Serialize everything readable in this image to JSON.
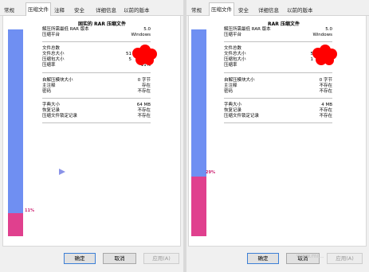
{
  "tabs": [
    "常规",
    "压缩文件",
    "注释",
    "安全",
    "详细信息",
    "以前的版本"
  ],
  "left": {
    "title": "固实的 RAR 压缩文件",
    "rows_a": [
      {
        "label": "解压所需最低 RAR 版本",
        "value": "5.0"
      },
      {
        "label": "压缩平台",
        "value": "Windows"
      }
    ],
    "rows_b": [
      {
        "label": "文件总数",
        "value": ""
      },
      {
        "label": "文件总大小",
        "value": "51"
      },
      {
        "label": "压缩包大小",
        "value": "5"
      },
      {
        "label": "压缩率",
        "value": "11%"
      }
    ],
    "rows_c": [
      {
        "label": "自解压模块大小",
        "value": "0 字节"
      },
      {
        "label": "主注释",
        "value": "存在"
      },
      {
        "label": "密码",
        "value": "不存在"
      }
    ],
    "rows_d": [
      {
        "label": "字典大小",
        "value": "64 MB"
      },
      {
        "label": "恢复记录",
        "value": "不存在"
      },
      {
        "label": "压缩文件锁定记录",
        "value": "不存在"
      }
    ],
    "ratio_percent": 11,
    "ratio_label": "11%"
  },
  "right": {
    "title": "RAR 压缩文件",
    "rows_a": [
      {
        "label": "解压所需最低 RAR 版本",
        "value": "5.0"
      },
      {
        "label": "压缩平台",
        "value": "Windows"
      }
    ],
    "rows_b": [
      {
        "label": "文件总数",
        "value": ""
      },
      {
        "label": "文件总大小",
        "value": "5"
      },
      {
        "label": "压缩包大小",
        "value": "1"
      },
      {
        "label": "压缩率",
        "value": ""
      }
    ],
    "rows_c": [
      {
        "label": "自解压模块大小",
        "value": "0 字节"
      },
      {
        "label": "主注释",
        "value": "不存在"
      },
      {
        "label": "密码",
        "value": "不存在"
      }
    ],
    "rows_d": [
      {
        "label": "字典大小",
        "value": "4 MB"
      },
      {
        "label": "恢复记录",
        "value": "不存在"
      },
      {
        "label": "压缩文件锁定记录",
        "value": "不存在"
      }
    ],
    "ratio_percent": 29,
    "ratio_label": "29%"
  },
  "buttons": {
    "ok": "确定",
    "cancel": "取消",
    "apply": "应用(A)"
  },
  "watermark": "www.mi...",
  "colors": {
    "bar_blue": "#6f8ff2",
    "bar_pink": "#e0408e",
    "redaction": "#ff0000"
  }
}
